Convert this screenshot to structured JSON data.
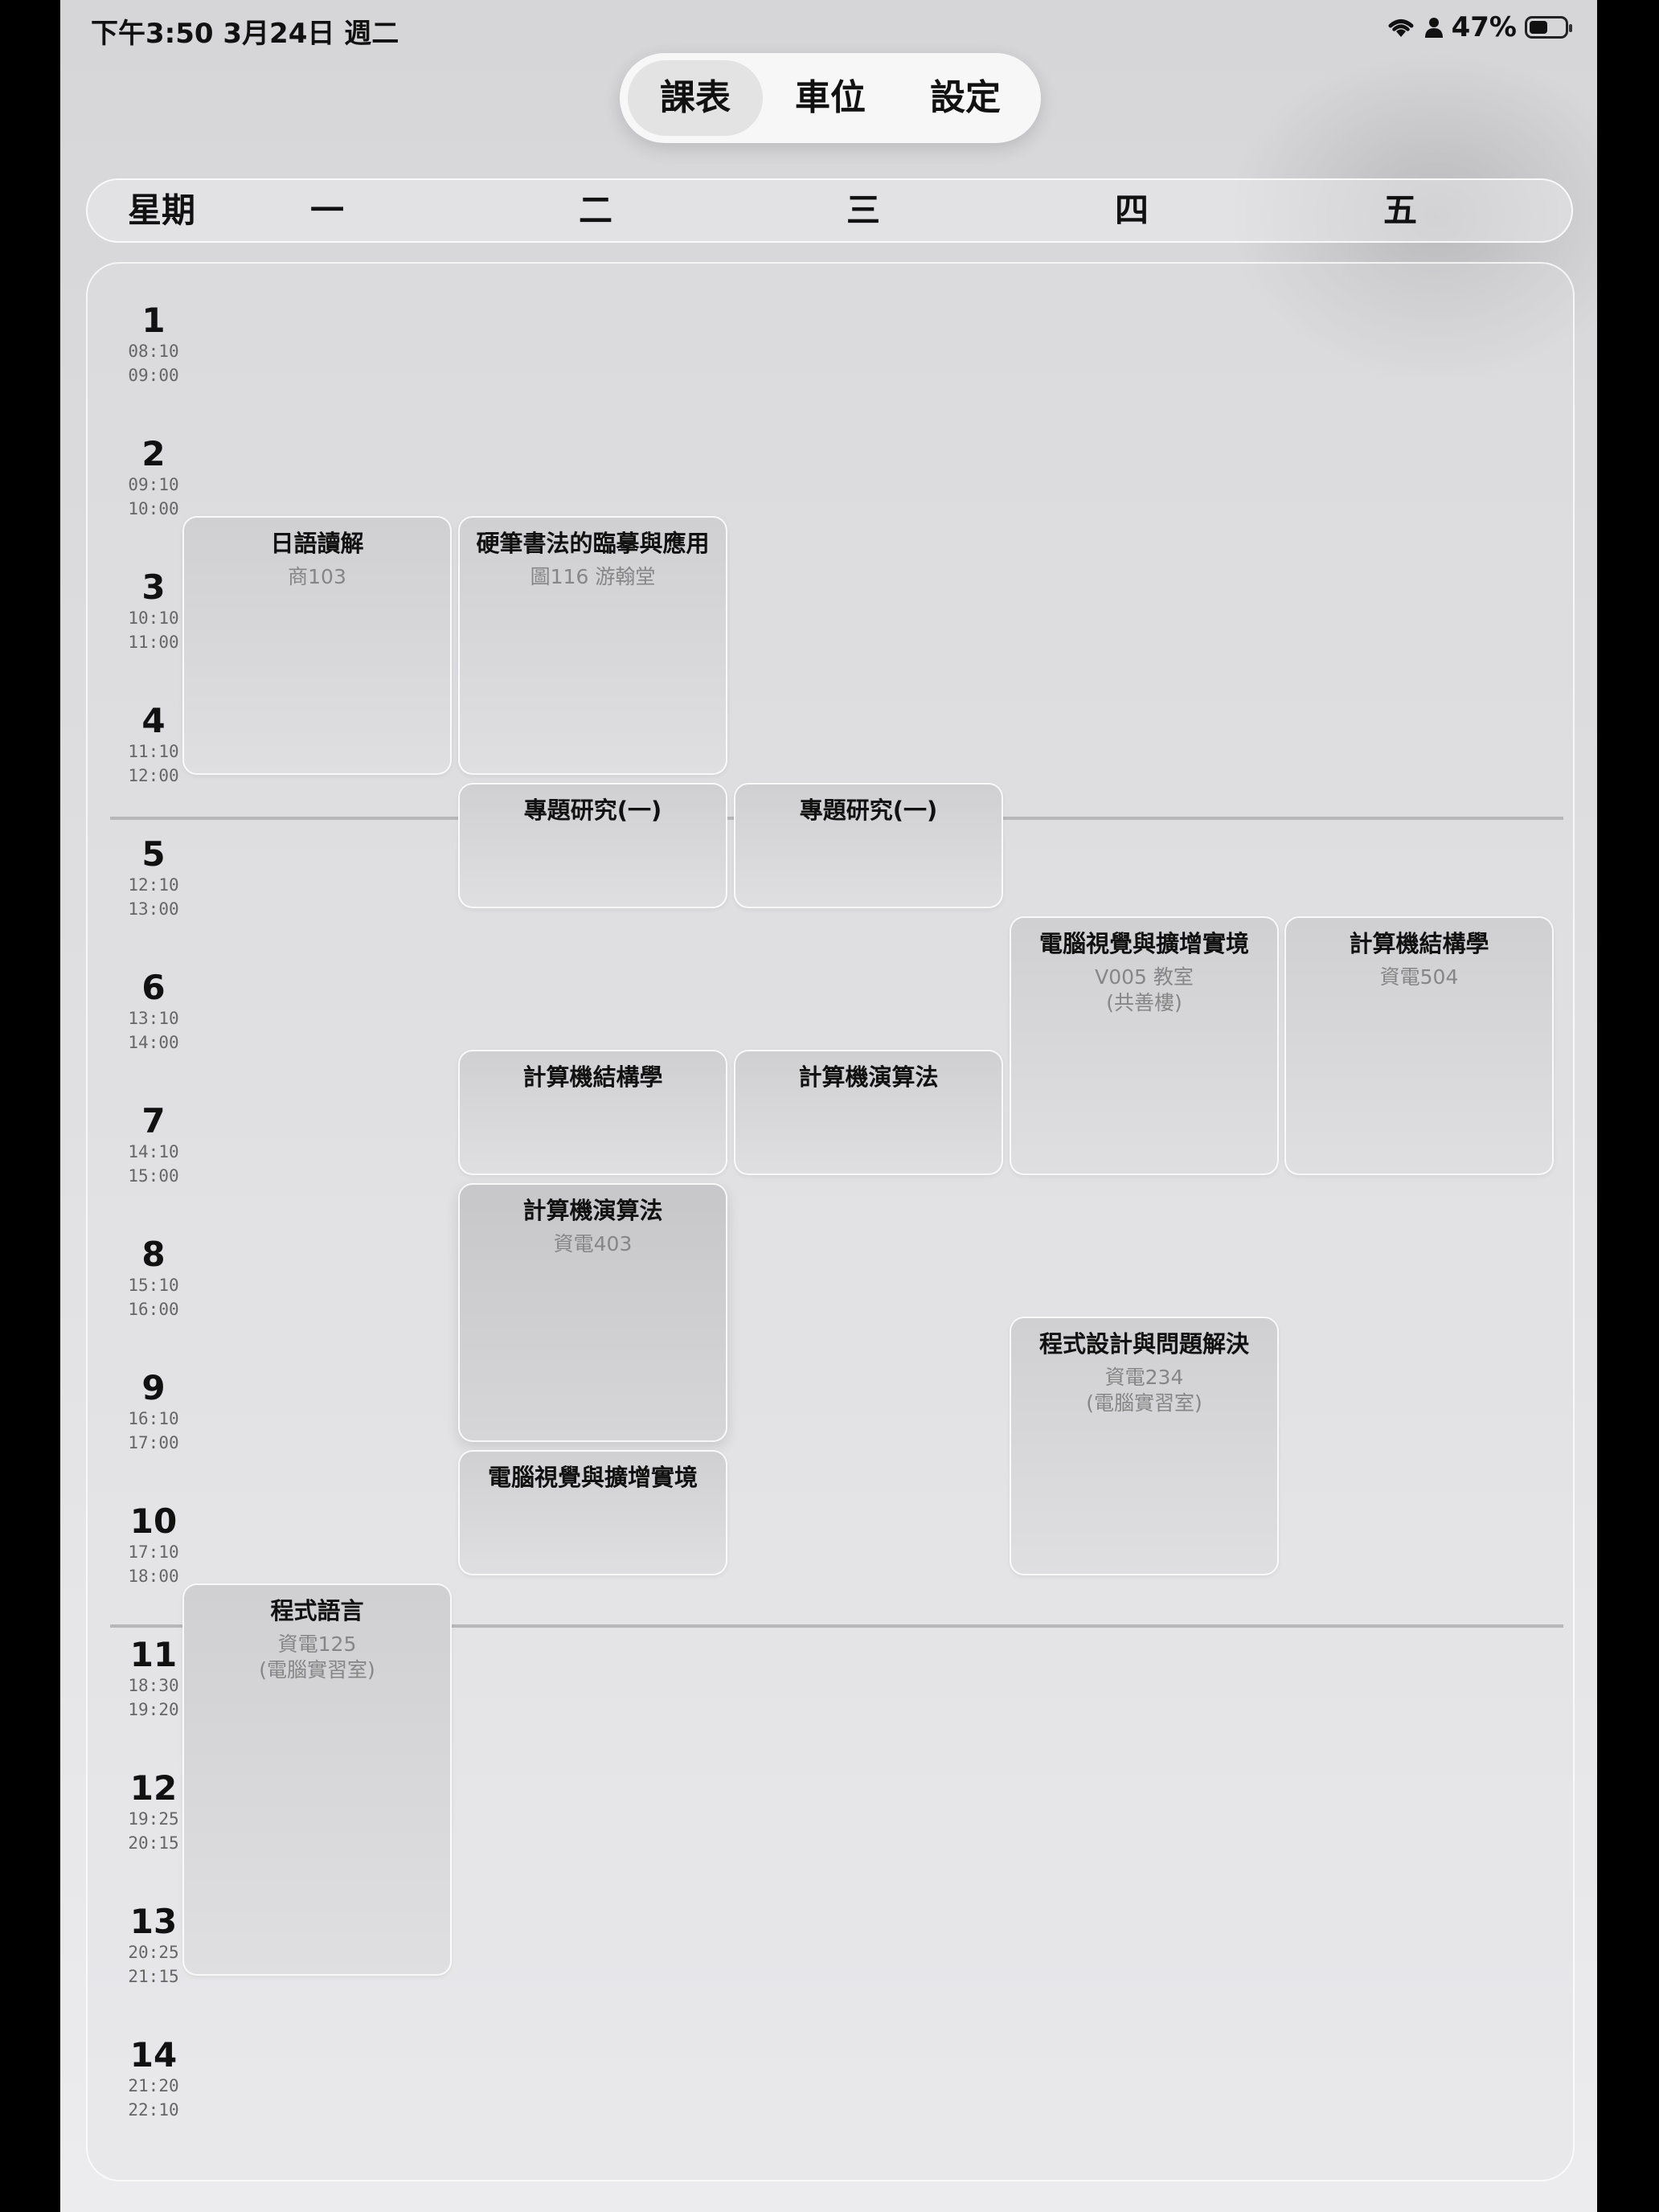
{
  "status_bar": {
    "time_date": "下午3:50   3月24日 週二",
    "battery": "47%",
    "icons": [
      "wifi-icon",
      "person-icon",
      "battery-icon"
    ]
  },
  "tabs": [
    {
      "label": "課表",
      "active": true
    },
    {
      "label": "車位",
      "active": false
    },
    {
      "label": "設定",
      "active": false
    }
  ],
  "weekday_header": {
    "label": "星期",
    "days": [
      "一",
      "二",
      "三",
      "四",
      "五"
    ]
  },
  "periods": [
    {
      "num": "1",
      "start": "08:10",
      "end": "09:00"
    },
    {
      "num": "2",
      "start": "09:10",
      "end": "10:00"
    },
    {
      "num": "3",
      "start": "10:10",
      "end": "11:00"
    },
    {
      "num": "4",
      "start": "11:10",
      "end": "12:00"
    },
    {
      "num": "5",
      "start": "12:10",
      "end": "13:00"
    },
    {
      "num": "6",
      "start": "13:10",
      "end": "14:00"
    },
    {
      "num": "7",
      "start": "14:10",
      "end": "15:00"
    },
    {
      "num": "8",
      "start": "15:10",
      "end": "16:00"
    },
    {
      "num": "9",
      "start": "16:10",
      "end": "17:00"
    },
    {
      "num": "10",
      "start": "17:10",
      "end": "18:00"
    },
    {
      "num": "11",
      "start": "18:30",
      "end": "19:20"
    },
    {
      "num": "12",
      "start": "19:25",
      "end": "20:15"
    },
    {
      "num": "13",
      "start": "20:25",
      "end": "21:15"
    },
    {
      "num": "14",
      "start": "21:20",
      "end": "22:10"
    }
  ],
  "courses": [
    {
      "title": "日語讀解",
      "room": "商103",
      "note": "",
      "day": 1,
      "start": 3,
      "span": 2
    },
    {
      "title": "硬筆書法的臨摹與應用",
      "room": "圖116 游翰堂",
      "note": "",
      "day": 2,
      "start": 3,
      "span": 2
    },
    {
      "title": "專題研究(一)",
      "room": "",
      "note": "",
      "day": 2,
      "start": 5,
      "span": 1
    },
    {
      "title": "專題研究(一)",
      "room": "",
      "note": "",
      "day": 3,
      "start": 5,
      "span": 1
    },
    {
      "title": "電腦視覺與擴增實境",
      "room": "V005 教室",
      "note": "(共善樓)",
      "day": 4,
      "start": 6,
      "span": 2
    },
    {
      "title": "計算機結構學",
      "room": "資電504",
      "note": "",
      "day": 5,
      "start": 6,
      "span": 2
    },
    {
      "title": "計算機結構學",
      "room": "",
      "note": "",
      "day": 2,
      "start": 7,
      "span": 1
    },
    {
      "title": "計算機演算法",
      "room": "",
      "note": "",
      "day": 3,
      "start": 7,
      "span": 1
    },
    {
      "title": "計算機演算法",
      "room": "資電403",
      "note": "",
      "day": 2,
      "start": 8,
      "span": 2,
      "selected": true
    },
    {
      "title": "程式設計與問題解決",
      "room": "資電234",
      "note": "(電腦實習室)",
      "day": 4,
      "start": 9,
      "span": 2
    },
    {
      "title": "電腦視覺與擴增實境",
      "room": "",
      "note": "",
      "day": 2,
      "start": 10,
      "span": 1
    },
    {
      "title": "程式語言",
      "room": "資電125",
      "note": "(電腦實習室)",
      "day": 1,
      "start": 11,
      "span": 3
    }
  ]
}
